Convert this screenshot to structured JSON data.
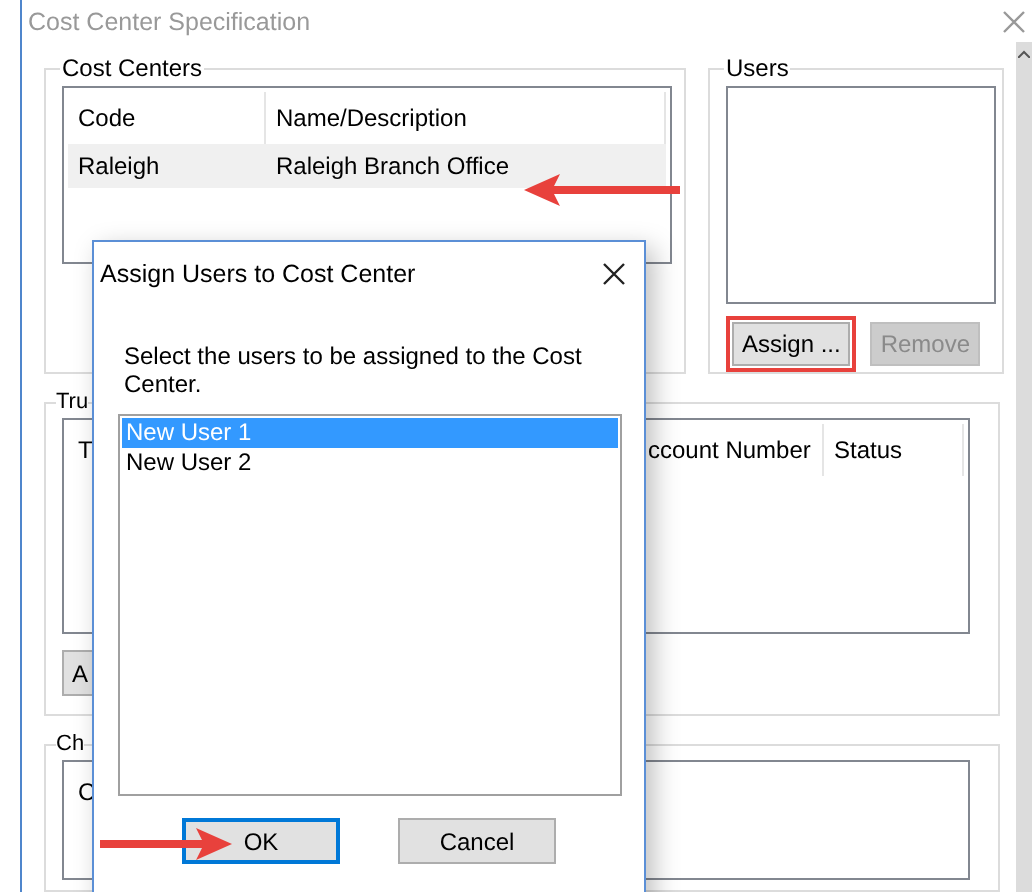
{
  "window": {
    "title": "Cost Center Specification"
  },
  "cost_centers": {
    "title": "Cost Centers",
    "columns": [
      "Code",
      "Name/Description"
    ],
    "rows": [
      {
        "cells": [
          "Raleigh",
          "Raleigh Branch Office"
        ],
        "selected": true
      }
    ]
  },
  "users": {
    "title": "Users",
    "buttons": [
      {
        "label": "Assign ...",
        "disabled": false,
        "highlighted": true
      },
      {
        "label": "Remove",
        "disabled": true,
        "highlighted": false
      }
    ]
  },
  "group_3": {
    "title": "Tru",
    "columns": [
      "T",
      "ccount Number",
      "Status"
    ],
    "button": "A"
  },
  "group_4": {
    "title": "Ch",
    "columns": [
      "C"
    ]
  },
  "dialog": {
    "title": "Assign Users to Cost Center",
    "instruction": "Select the users to be assigned to the Cost Center.",
    "users": [
      {
        "name": "New User 1",
        "selected": true
      },
      {
        "name": "New User 2",
        "selected": false
      }
    ],
    "buttons": [
      {
        "label": "OK",
        "default": true
      },
      {
        "label": "Cancel",
        "default": false
      }
    ]
  },
  "annotations": [
    {
      "kind": "leftarrow"
    },
    {
      "kind": "rightarrow"
    }
  ]
}
